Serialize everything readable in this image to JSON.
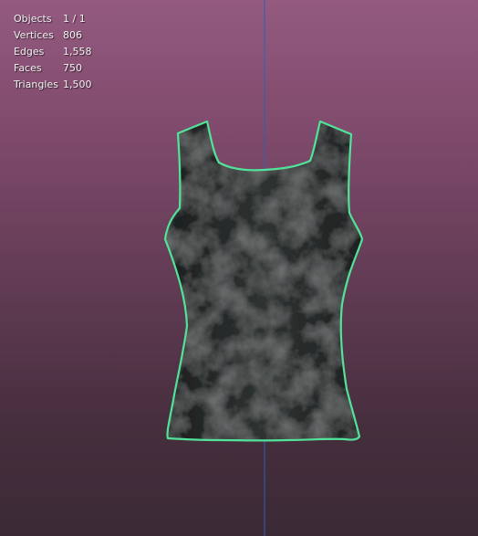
{
  "viewport": {
    "background_top": "#945a80",
    "background_bottom": "#3b2a36",
    "axis_line_color": "#2f5fb0",
    "selection_outline_color": "#52e39a"
  },
  "stats": [
    {
      "label": "Objects",
      "value": "1 / 1"
    },
    {
      "label": "Vertices",
      "value": "806"
    },
    {
      "label": "Edges",
      "value": "1,558"
    },
    {
      "label": "Faces",
      "value": "750"
    },
    {
      "label": "Triangles",
      "value": "1,500"
    }
  ]
}
